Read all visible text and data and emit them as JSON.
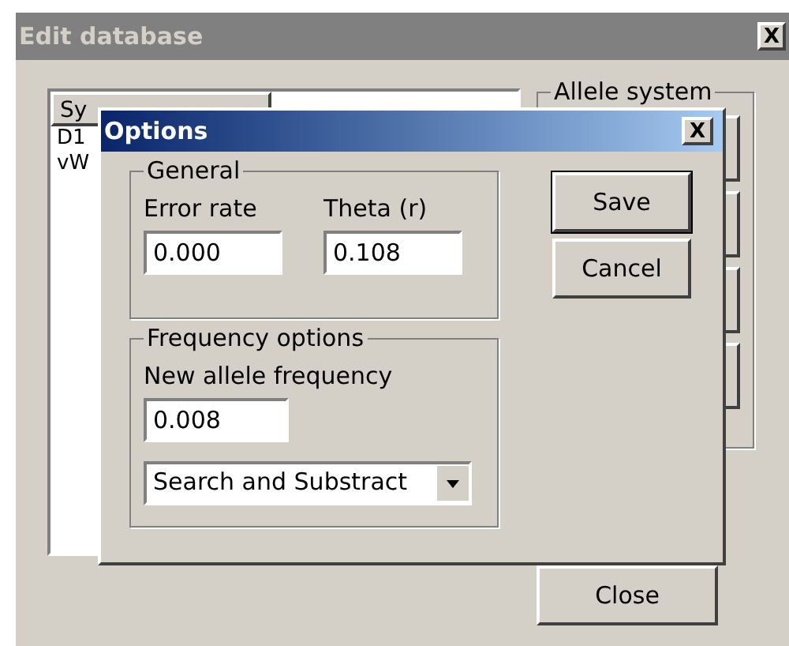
{
  "window": {
    "title": "Edit database",
    "close": "X"
  },
  "list": {
    "column_1": "Sy",
    "rows": [
      "D1",
      "vW"
    ]
  },
  "allele_group": {
    "title": "Allele system"
  },
  "close_button": "Close",
  "dialog": {
    "title": "Options",
    "close": "X",
    "general": {
      "title": "General",
      "error_rate": {
        "label": "Error rate",
        "value": "0.000"
      },
      "theta": {
        "label": "Theta (r)",
        "value": "0.108"
      }
    },
    "frequency": {
      "title": "Frequency options",
      "new_allele": {
        "label": "New allele frequency",
        "value": "0.008"
      },
      "method": {
        "value": "Search and Substract"
      }
    },
    "buttons": [
      {
        "label": "Save",
        "default": true
      },
      {
        "label": "Cancel",
        "default": false
      }
    ]
  }
}
